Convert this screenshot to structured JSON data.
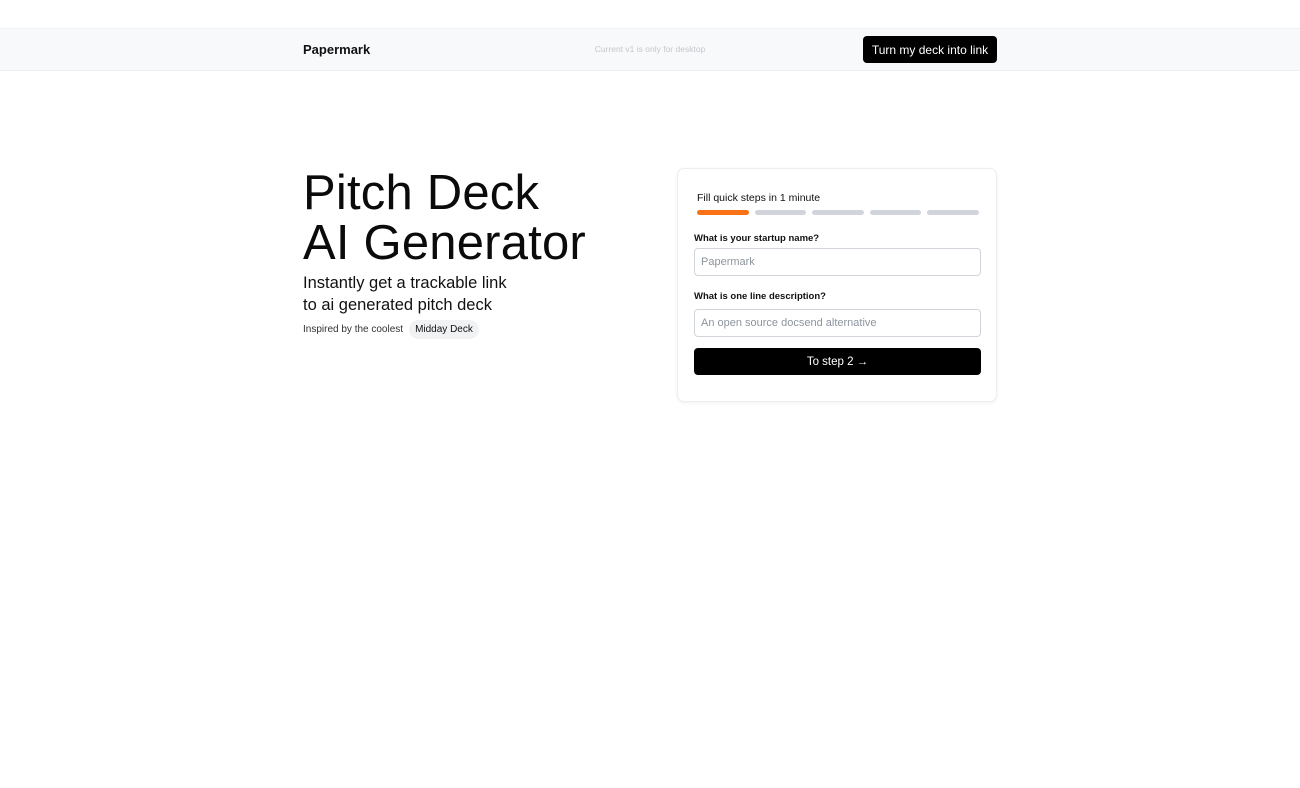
{
  "header": {
    "brand": "Papermark",
    "notice": "Current v1 is only for desktop",
    "cta_label": "Turn my deck into link"
  },
  "hero": {
    "title_line1": "Pitch Deck",
    "title_line2": "AI Generator",
    "subtitle_line1": "Instantly get a trackable link",
    "subtitle_line2": "to ai generated pitch deck",
    "inspired_text": "Inspired by the coolest",
    "inspired_pill": "Midday Deck"
  },
  "form": {
    "steps_label": "Fill quick steps in 1 minute",
    "current_step": 1,
    "total_steps": 5,
    "startup_name_label": "What is your startup name?",
    "startup_name_placeholder": "Papermark",
    "startup_name_value": "",
    "description_label": "What is one line description?",
    "description_placeholder": "An open source docsend alternative",
    "description_value": "",
    "submit_label": "To step 2 →"
  },
  "colors": {
    "accent": "#f97316",
    "button": "#000000",
    "header_bg": "#f8f9fa",
    "inactive_step": "#d1d5db"
  }
}
